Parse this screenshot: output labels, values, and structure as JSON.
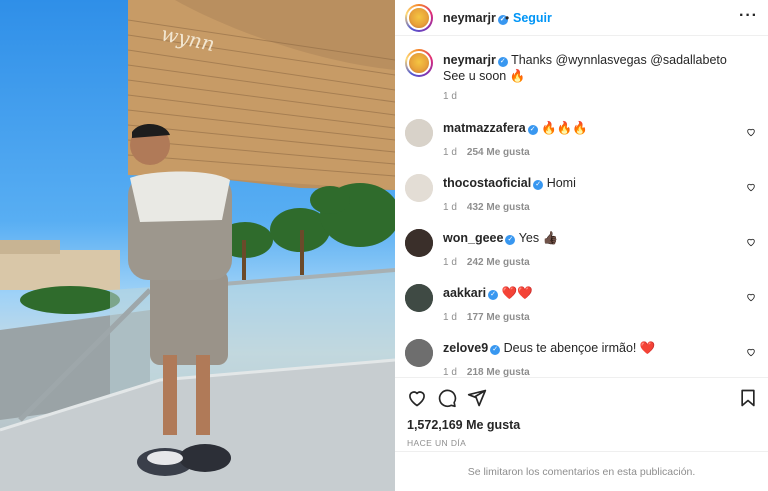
{
  "post": {
    "author": "neymarjr",
    "follow_label": "Seguir",
    "separator": "•",
    "more_icon": "more-horizontal-icon",
    "likes": "1,572,169 Me gusta",
    "posted": "HACE UN DÍA",
    "comments_limited": "Se limitaron los comentarios en esta publicación."
  },
  "caption": {
    "username": "neymarjr",
    "line1": "Thanks @wynnlasvegas @sadallabeto",
    "line2": "See u soon 🔥",
    "time": "1 d"
  },
  "comments": [
    {
      "username": "matmazzafera",
      "text": "🔥🔥🔥",
      "time": "1 d",
      "likes": "254 Me gusta"
    },
    {
      "username": "thocostaoficial",
      "text": "Homi",
      "time": "1 d",
      "likes": "432 Me gusta"
    },
    {
      "username": "won_geee",
      "text": "Yes 👍🏿",
      "time": "1 d",
      "likes": "242 Me gusta"
    },
    {
      "username": "aakkari",
      "text": "❤️❤️",
      "time": "1 d",
      "likes": "177 Me gusta"
    },
    {
      "username": "zelove9",
      "text": "Deus te abençoe irmão! ❤️",
      "time": "1 d",
      "likes": "218 Me gusta"
    }
  ],
  "photo": {
    "building_sign": "wynn"
  },
  "icons": {
    "like": "heart-icon",
    "comment": "comment-icon",
    "share": "send-icon",
    "save": "bookmark-icon"
  },
  "colors": {
    "accent": "#0095f6",
    "verified": "#3897f0",
    "heart_red": "#ed4956"
  }
}
